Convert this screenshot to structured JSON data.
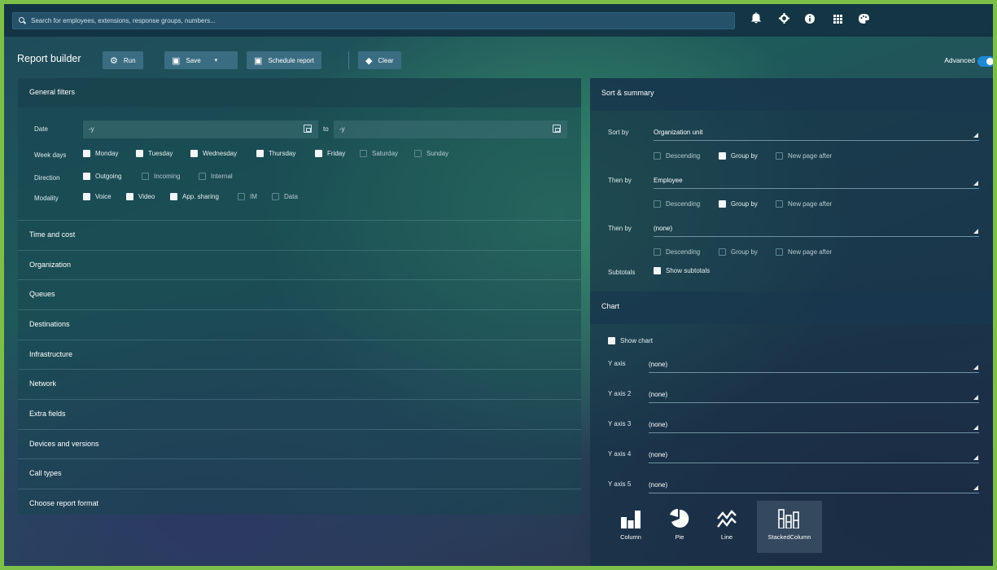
{
  "topbar": {
    "search_placeholder": "Search for employees, extensions, response groups, numbers...",
    "icons": [
      "bell-icon",
      "gear-icon",
      "info-icon",
      "grid-icon",
      "palette-icon"
    ]
  },
  "toolbar": {
    "title": "Report builder",
    "run_label": "Run",
    "save_label": "Save",
    "schedule_label": "Schedule report",
    "clear_label": "Clear",
    "advanced_label": "Advanced",
    "advanced_on": true
  },
  "general_filters": {
    "title": "General filters",
    "date_label": "Date",
    "date_from": "-y",
    "date_to_label": "to",
    "date_to": "-y",
    "week_days_label": "Week days",
    "week_days": [
      {
        "label": "Monday",
        "checked": true
      },
      {
        "label": "Tuesday",
        "checked": true
      },
      {
        "label": "Wednesday",
        "checked": true
      },
      {
        "label": "Thursday",
        "checked": true
      },
      {
        "label": "Friday",
        "checked": true
      },
      {
        "label": "Saturday",
        "checked": false
      },
      {
        "label": "Sunday",
        "checked": false
      }
    ],
    "direction_label": "Direction",
    "direction": [
      {
        "label": "Outgoing",
        "checked": true
      },
      {
        "label": "Incoming",
        "checked": false
      },
      {
        "label": "Internal",
        "checked": false
      }
    ],
    "modality_label": "Modality",
    "modality": [
      {
        "label": "Voice",
        "checked": true
      },
      {
        "label": "Video",
        "checked": true
      },
      {
        "label": "App. sharing",
        "checked": true
      },
      {
        "label": "IM",
        "checked": false
      },
      {
        "label": "Data",
        "checked": false
      }
    ]
  },
  "sections": [
    "Time and cost",
    "Organization",
    "Queues",
    "Destinations",
    "Infrastructure",
    "Network",
    "Extra fields",
    "Devices and versions",
    "Call types",
    "Choose report format"
  ],
  "sort_summary": {
    "title": "Sort & summary",
    "sort_by_label": "Sort by",
    "sort_by": "Organization unit",
    "then_by_label": "Then by",
    "then_by_1": "Employee",
    "then_by_2": "(none)",
    "descending_label": "Descending",
    "group_by_label": "Group by",
    "new_page_label": "New page after",
    "rows_group_by": [
      true,
      true,
      false
    ],
    "subtotals_label": "Subtotals",
    "show_subtotals_label": "Show subtotals"
  },
  "chart": {
    "title": "Chart",
    "show_chart_label": "Show chart",
    "y_axes": [
      {
        "label": "Y axis",
        "value": "(none)"
      },
      {
        "label": "Y axis 2",
        "value": "(none)"
      },
      {
        "label": "Y axis 3",
        "value": "(none)"
      },
      {
        "label": "Y axis 4",
        "value": "(none)"
      },
      {
        "label": "Y axis 5",
        "value": "(none)"
      }
    ],
    "types": [
      "Column",
      "Pie",
      "Line",
      "StackedColumn"
    ],
    "selected_type": "StackedColumn"
  }
}
